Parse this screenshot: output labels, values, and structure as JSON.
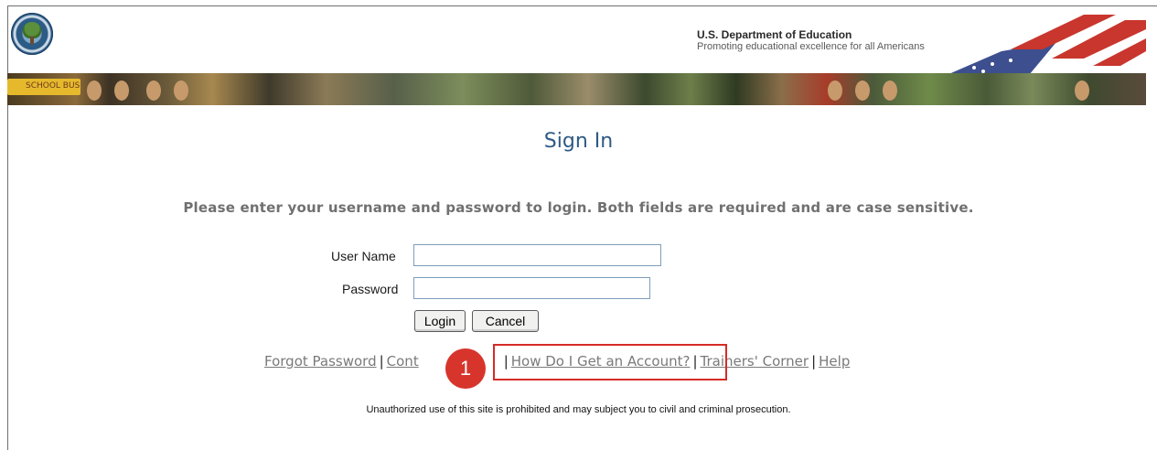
{
  "header": {
    "org_name": "U.S. Department of Education",
    "tagline": "Promoting educational excellence for all Americans",
    "banner_bus_label": "SCHOOL BUS"
  },
  "main": {
    "title": "Sign In",
    "instructions": "Please enter your username and password to login. Both fields are required and are case sensitive.",
    "username_label": "User Name",
    "username_value": "",
    "password_label": "Password",
    "password_value": "",
    "login_label": "Login",
    "cancel_label": "Cancel"
  },
  "links": {
    "forgot_password": "Forgot Password",
    "contact": "Cont",
    "how_account": "How Do I Get an Account?",
    "trainers_corner": "Trainers' Corner",
    "help": "Help",
    "separator": "|"
  },
  "callout": {
    "number": "1",
    "color": "#d7352c"
  },
  "notice": "Unauthorized use of this site is prohibited and may subject you to civil and criminal prosecution.",
  "colors": {
    "title": "#2e5a85",
    "highlight": "#d52b27"
  }
}
